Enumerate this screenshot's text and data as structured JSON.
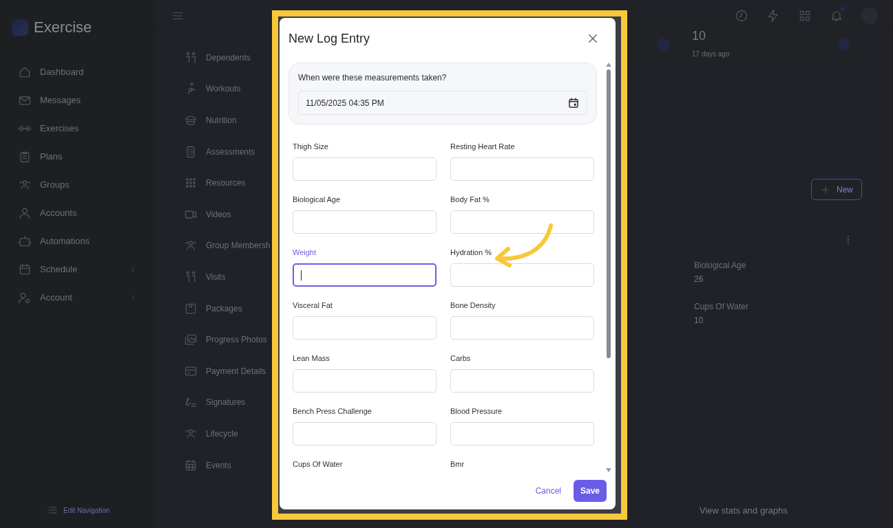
{
  "app": {
    "logo_text": "Exercise"
  },
  "sidebar": {
    "items": [
      {
        "label": "Dashboard",
        "expandable": false
      },
      {
        "label": "Messages",
        "expandable": false
      },
      {
        "label": "Exercises",
        "expandable": false
      },
      {
        "label": "Plans",
        "expandable": false
      },
      {
        "label": "Groups",
        "expandable": false
      },
      {
        "label": "Accounts",
        "expandable": false
      },
      {
        "label": "Automations",
        "expandable": false
      },
      {
        "label": "Schedule",
        "expandable": true
      },
      {
        "label": "Account",
        "expandable": true
      }
    ],
    "edit_link": "Edit Navigation"
  },
  "subnav": {
    "items": [
      "Dependents",
      "Workouts",
      "Nutrition",
      "Assessments",
      "Resources",
      "Videos",
      "Group Membersh",
      "Visits",
      "Packages",
      "Progress Photos",
      "Payment Details",
      "Signatures",
      "Lifecycle",
      "Events"
    ]
  },
  "topbar": {
    "notification_dot": true
  },
  "content": {
    "summary_value": "10",
    "summary_time": "17 days ago",
    "new_button": "New",
    "details": [
      {
        "label": "Biological Age",
        "value": "26"
      },
      {
        "label": "Cups Of Water",
        "value": "10"
      }
    ],
    "stats_link": "View stats and graphs"
  },
  "modal": {
    "title": "New Log Entry",
    "date_prompt": "When were these measurements taken?",
    "date_value": "11/05/2025 04:35 PM",
    "fields": [
      {
        "label": "Thigh Size",
        "kind": "field",
        "focused": false
      },
      {
        "label": "Resting Heart Rate",
        "kind": "field",
        "focused": false
      },
      {
        "label": "Biological Age",
        "kind": "field",
        "focused": false
      },
      {
        "label": "Body Fat %",
        "kind": "field",
        "focused": false
      },
      {
        "label": "Weight",
        "kind": "field",
        "focused": true
      },
      {
        "label": "Hydration %",
        "kind": "field",
        "focused": false
      },
      {
        "label": "Visceral Fat",
        "kind": "field",
        "focused": false
      },
      {
        "label": "Bone Density",
        "kind": "field",
        "focused": false
      },
      {
        "label": "Lean Mass",
        "kind": "field",
        "focused": false
      },
      {
        "label": "Carbs",
        "kind": "field",
        "focused": false
      },
      {
        "label": "Bench Press Challenge",
        "kind": "field",
        "focused": false
      },
      {
        "label": "Blood Pressure",
        "kind": "field",
        "focused": false
      },
      {
        "label": "Cups Of Water",
        "kind": "label_only",
        "focused": false
      },
      {
        "label": "Bmr",
        "kind": "label_only",
        "focused": false
      }
    ],
    "cancel": "Cancel",
    "save": "Save"
  }
}
